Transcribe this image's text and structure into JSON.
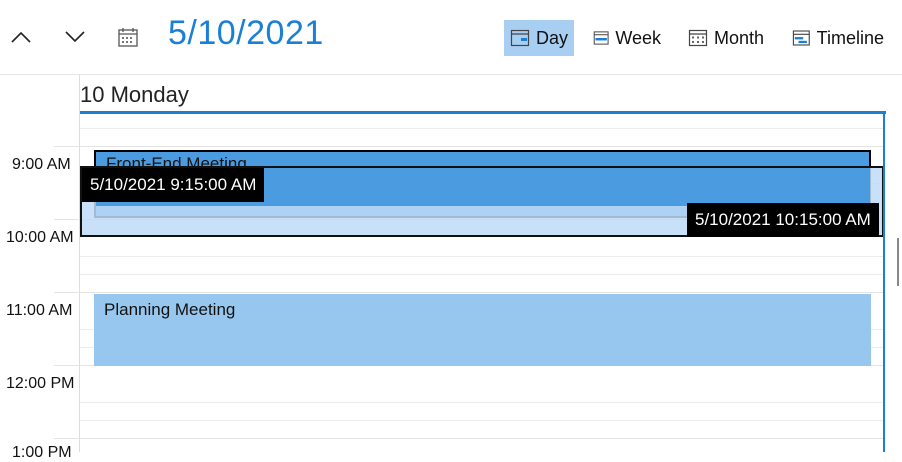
{
  "toolbar": {
    "date_title": "5/10/2021",
    "views": [
      {
        "label": "Day",
        "active": true
      },
      {
        "label": "Week",
        "active": false
      },
      {
        "label": "Month",
        "active": false
      },
      {
        "label": "Timeline",
        "active": false
      }
    ]
  },
  "day_header": "10 Monday",
  "time_labels": [
    "9:00 AM",
    "10:00 AM",
    "11:00 AM",
    "12:00 PM",
    "1:00 PM"
  ],
  "appointments": [
    {
      "subject": "Front-End Meeting"
    },
    {
      "subject": "Planning Meeting"
    }
  ],
  "drag_tooltips": {
    "start": "5/10/2021 9:15:00 AM",
    "end": "5/10/2021 10:15:00 AM"
  },
  "colors": {
    "accent": "#1a7fd6",
    "appointment_selected": "#4a9be0",
    "appointment": "#97c7ee",
    "active_view": "#a8cff2"
  }
}
